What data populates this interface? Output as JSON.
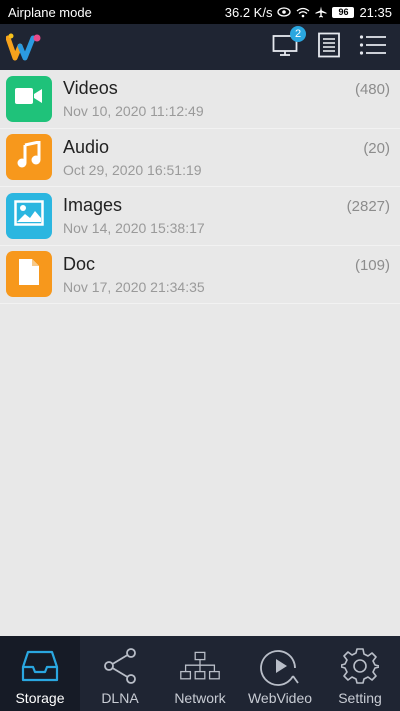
{
  "status_bar": {
    "left_text": "Airplane mode",
    "speed": "36.2 K/s",
    "battery": "96",
    "time": "21:35"
  },
  "app_bar": {
    "devices_badge": "2",
    "icons": [
      "app-logo-icon",
      "screen-cast-icon",
      "document-icon",
      "list-menu-icon"
    ]
  },
  "items": [
    {
      "title": "Videos",
      "count": "(480)",
      "date": "Nov 10, 2020 11:12:49",
      "color": "#1fc27a",
      "icon": "video-camera-icon"
    },
    {
      "title": "Audio",
      "count": "(20)",
      "date": "Oct 29, 2020 16:51:19",
      "color": "#f7981c",
      "icon": "music-note-icon"
    },
    {
      "title": "Images",
      "count": "(2827)",
      "date": "Nov 14, 2020 15:38:17",
      "color": "#2bb6e0",
      "icon": "image-icon"
    },
    {
      "title": "Doc",
      "count": "(109)",
      "date": "Nov 17, 2020 21:34:35",
      "color": "#f7981c",
      "icon": "document-file-icon"
    }
  ],
  "nav": {
    "storage": "Storage",
    "dlna": "DLNA",
    "network": "Network",
    "webvideo": "WebVideo",
    "setting": "Setting",
    "active": "storage"
  },
  "colors": {
    "bar_bg": "#1f2533",
    "list_bg": "#e8e8e8",
    "badge": "#2aa7e0"
  }
}
